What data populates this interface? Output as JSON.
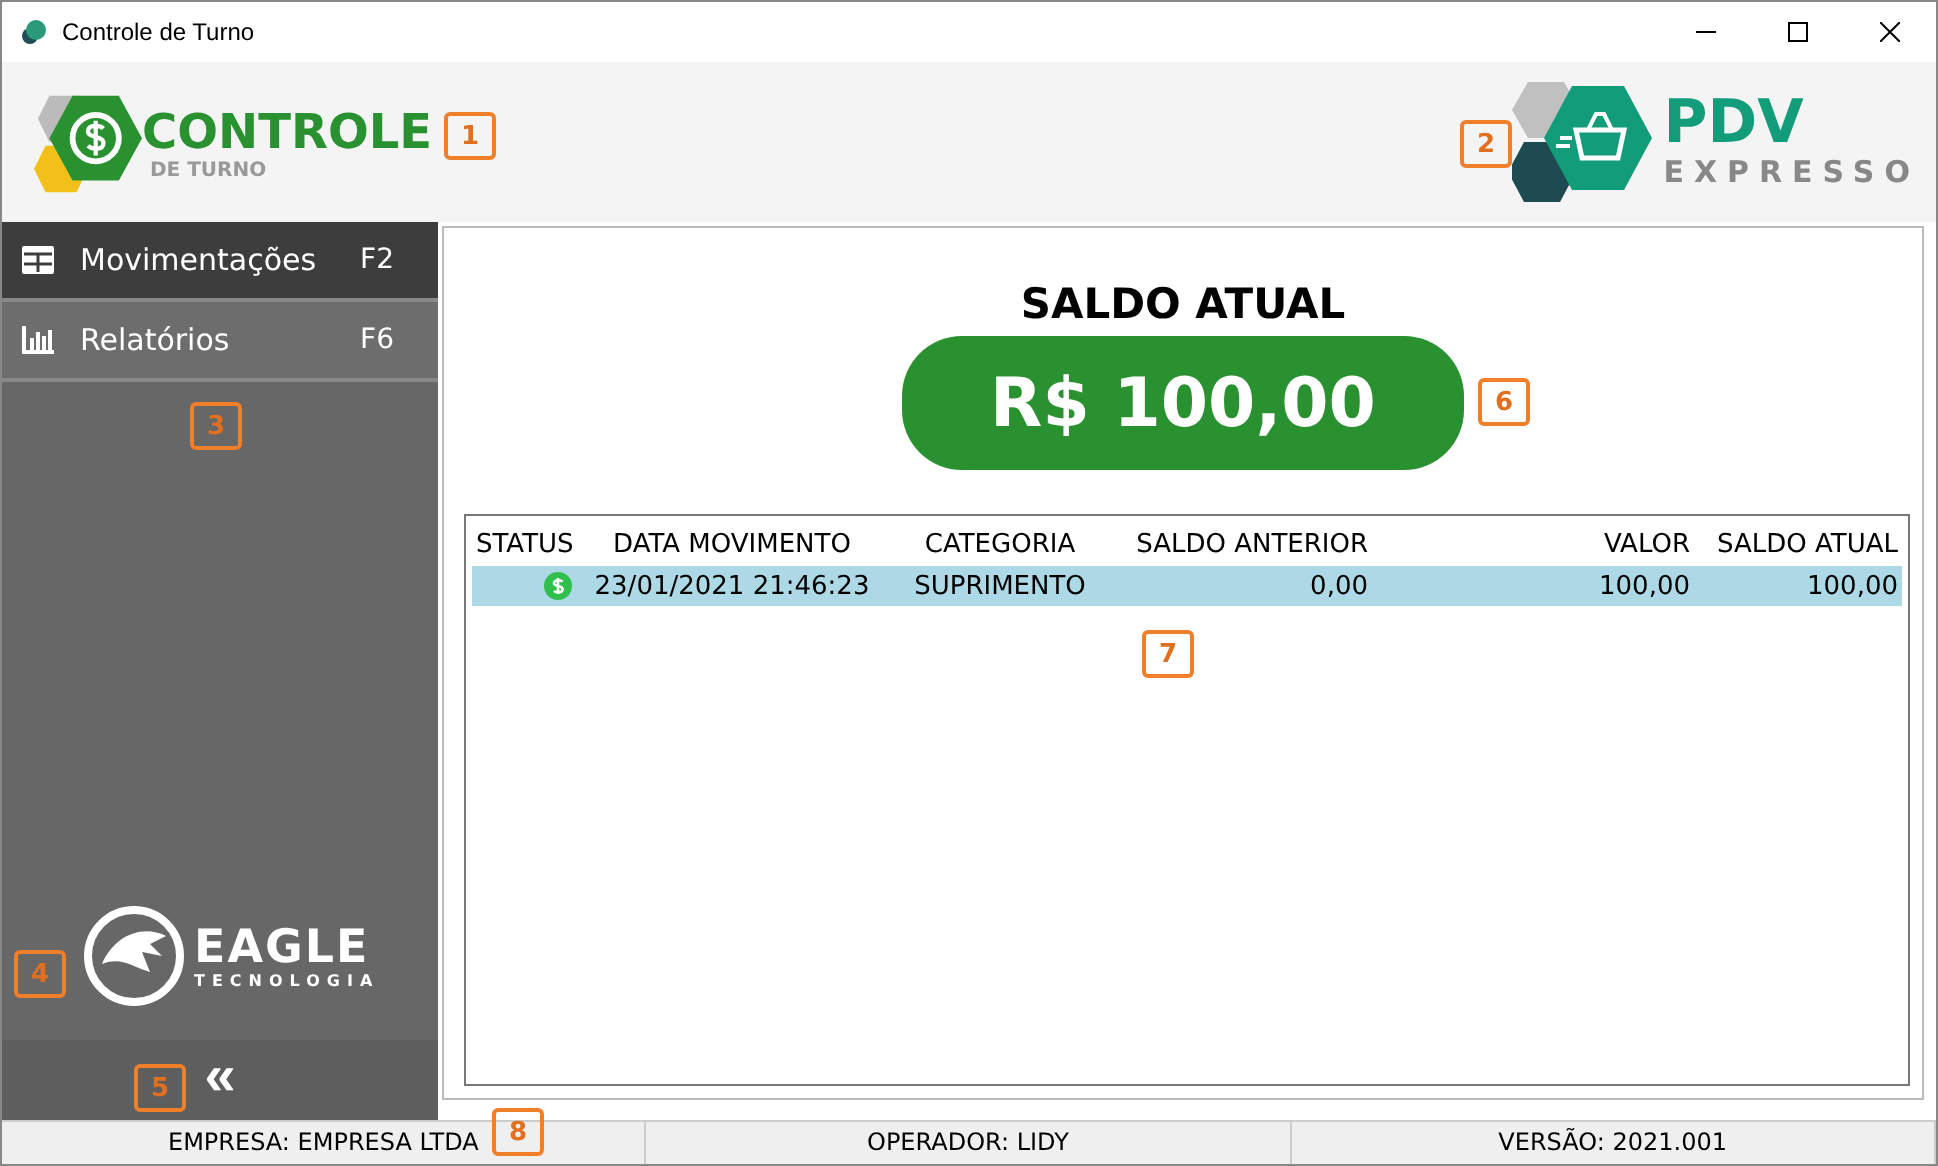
{
  "window": {
    "title": "Controle de Turno"
  },
  "header": {
    "logo_left": {
      "title": "CONTROLE",
      "subtitle": "DE TURNO"
    },
    "logo_right": {
      "title": "PDV",
      "subtitle": "EXPRESSO"
    }
  },
  "sidebar": {
    "items": [
      {
        "label": "Movimentações",
        "shortcut": "F2",
        "kind": "table",
        "selected": true
      },
      {
        "label": "Relatórios",
        "shortcut": "F6",
        "kind": "chart",
        "selected": false
      }
    ],
    "footer_logo": {
      "title": "EAGLE",
      "subtitle": "TECNOLOGIA"
    },
    "collapse": "«"
  },
  "balance": {
    "title": "SALDO ATUAL",
    "value": "R$ 100,00"
  },
  "table": {
    "columns": [
      "STATUS",
      "DATA MOVIMENTO",
      "CATEGORIA",
      "SALDO ANTERIOR",
      "VALOR",
      "SALDO ATUAL"
    ],
    "rows": [
      {
        "selected": true,
        "cells": [
          "",
          "23/01/2021 21:46:23",
          "SUPRIMENTO",
          "0,00",
          "100,00",
          "100,00"
        ]
      }
    ]
  },
  "status_bar": [
    "EMPRESA: EMPRESA LTDA",
    "OPERADOR: LIDY",
    "VERSÃO: 2021.001"
  ],
  "callouts": [
    "1",
    "2",
    "3",
    "4",
    "5",
    "6",
    "7",
    "8"
  ]
}
